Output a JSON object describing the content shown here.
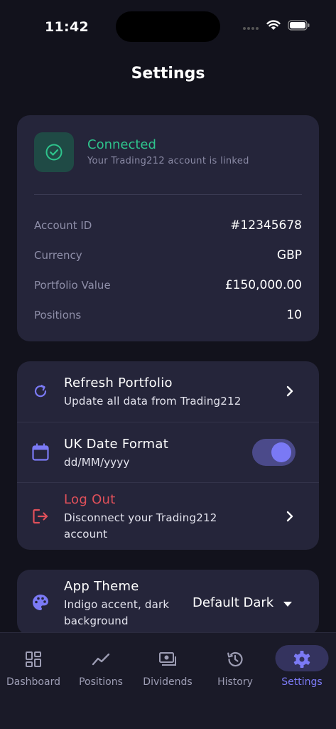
{
  "status_bar": {
    "time": "11:42"
  },
  "page": {
    "title": "Settings"
  },
  "connection": {
    "title": "Connected",
    "subtitle": "Your Trading212 account is linked",
    "rows": [
      {
        "label": "Account ID",
        "value": "#12345678"
      },
      {
        "label": "Currency",
        "value": "GBP"
      },
      {
        "label": "Portfolio Value",
        "value": "£150,000.00"
      },
      {
        "label": "Positions",
        "value": "10"
      }
    ]
  },
  "actions": {
    "refresh": {
      "title": "Refresh Portfolio",
      "subtitle": "Update all data from Trading212"
    },
    "date_format": {
      "title": "UK Date Format",
      "subtitle": "dd/MM/yyyy",
      "enabled": true
    },
    "logout": {
      "title": "Log Out",
      "subtitle": "Disconnect your Trading212 account"
    }
  },
  "theme": {
    "title": "App Theme",
    "subtitle": "Indigo accent, dark background",
    "selected": "Default Dark"
  },
  "tabs": [
    {
      "label": "Dashboard",
      "icon": "dashboard-icon"
    },
    {
      "label": "Positions",
      "icon": "trend-line-icon"
    },
    {
      "label": "Dividends",
      "icon": "cash-icon"
    },
    {
      "label": "History",
      "icon": "history-icon"
    },
    {
      "label": "Settings",
      "icon": "gear-icon",
      "active": true
    }
  ],
  "colors": {
    "accent": "#7b7af5",
    "success": "#2ec48c",
    "danger": "#e0505a",
    "card": "#25253a",
    "background": "#12121c"
  }
}
